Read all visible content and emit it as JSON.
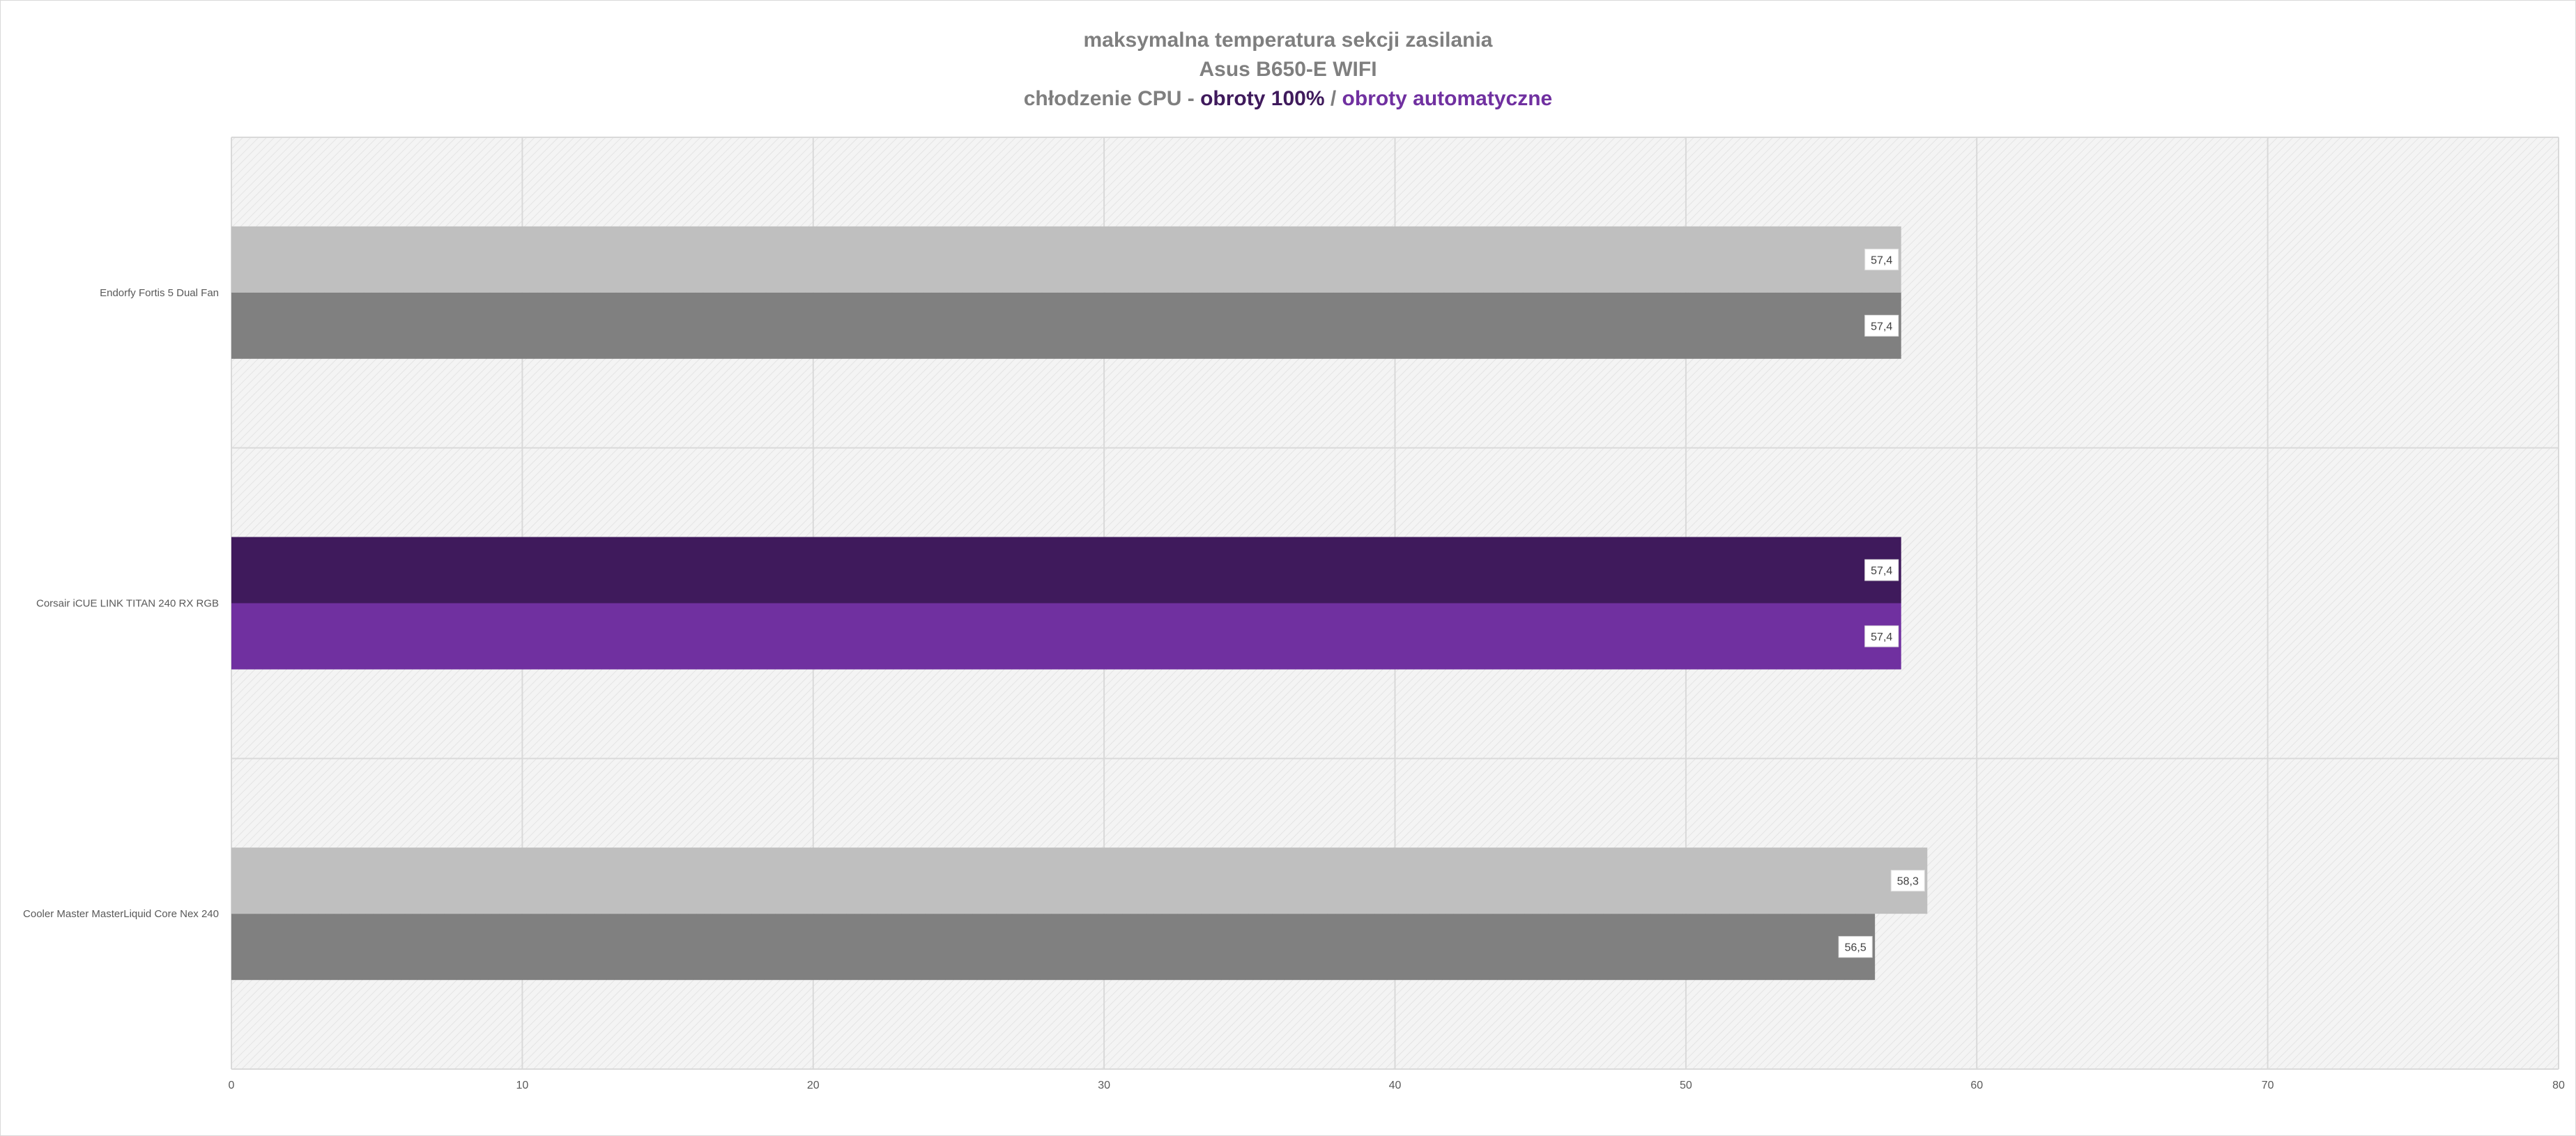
{
  "title": {
    "line1": "maksymalna temperatura sekcji zasilania",
    "line2": "Asus B650-E WIFI",
    "line3_prefix": "chłodzenie CPU - ",
    "line3_series1": "obroty 100%",
    "line3_sep": " / ",
    "line3_series2": "obroty automatyczne"
  },
  "colors": {
    "title_gray": "#7f7f7f",
    "series_100_highlight": "#3f1a5c",
    "series_auto_highlight": "#7030a0",
    "series_100_default": "#bfbfbf",
    "series_auto_default": "#808080",
    "gridline": "#d9d9d9",
    "plot_background": "#f2f2f2"
  },
  "chart_data": {
    "type": "bar",
    "orientation": "horizontal",
    "categories": [
      "Endorfy Fortis 5 Dual Fan",
      "Corsair iCUE LINK TITAN 240 RX RGB",
      "Cooler Master MasterLiquid Core Nex 240"
    ],
    "series": [
      {
        "name": "obroty 100%",
        "values": [
          57.4,
          57.4,
          58.3
        ],
        "data_labels": [
          "57,4",
          "57,4",
          "58,3"
        ]
      },
      {
        "name": "obroty automatyczne",
        "values": [
          57.4,
          57.4,
          56.5
        ],
        "data_labels": [
          "57,4",
          "57,4",
          "56,5"
        ]
      }
    ],
    "highlighted_category": "Corsair iCUE LINK TITAN 240 RX RGB",
    "xlim": [
      0,
      80
    ],
    "x_ticks": [
      0,
      10,
      20,
      30,
      40,
      50,
      60,
      70,
      80
    ],
    "x_tick_labels": [
      "0",
      "10",
      "20",
      "30",
      "40",
      "50",
      "60",
      "70",
      "80"
    ],
    "grid": true,
    "legend": "none"
  }
}
